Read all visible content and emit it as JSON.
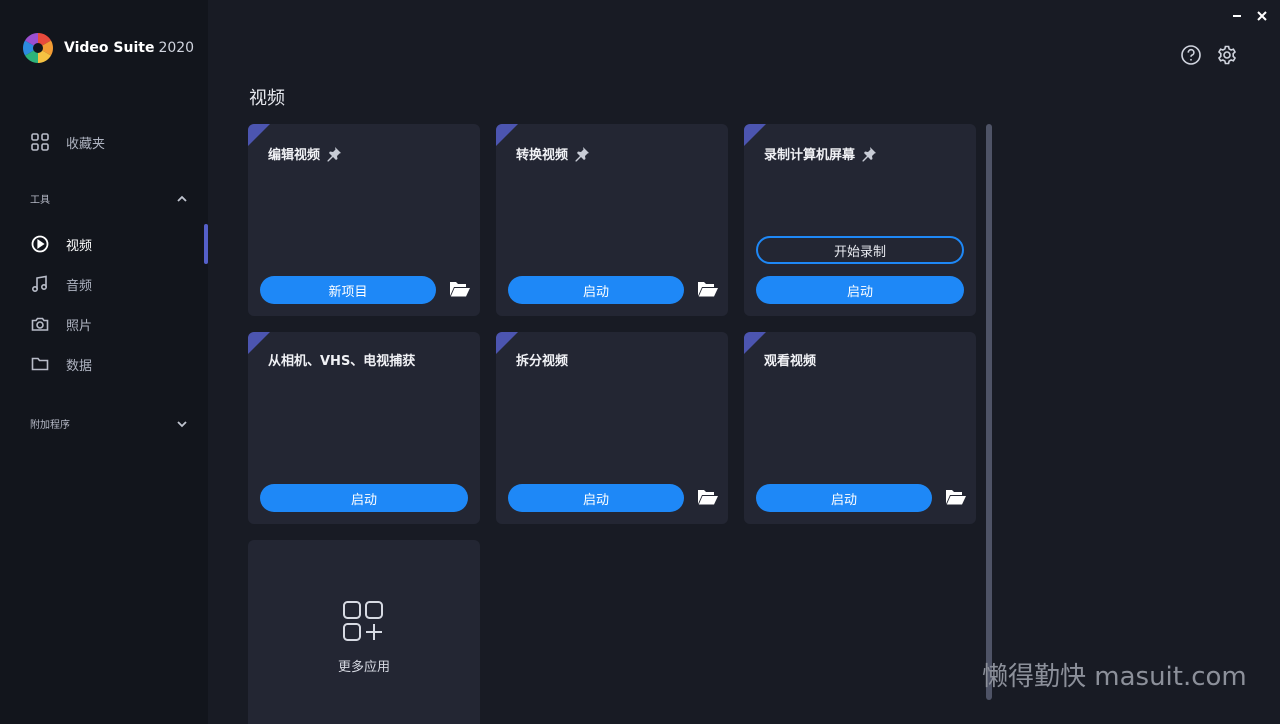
{
  "app": {
    "name": "Video Suite",
    "year": "2020"
  },
  "sidebar": {
    "favorites_label": "收藏夹",
    "tools_section": "工具",
    "items": [
      {
        "label": "视频",
        "icon": "play-circle-icon",
        "active": true
      },
      {
        "label": "音频",
        "icon": "music-note-icon",
        "active": false
      },
      {
        "label": "照片",
        "icon": "camera-icon",
        "active": false
      },
      {
        "label": "数据",
        "icon": "folder-icon",
        "active": false
      }
    ],
    "addons_section": "附加程序"
  },
  "page_title": "视频",
  "cards": [
    {
      "title": "编辑视频",
      "pinned": true,
      "button": "新项目",
      "has_folder": true
    },
    {
      "title": "转换视频",
      "pinned": true,
      "button": "启动",
      "has_folder": true
    },
    {
      "title": "录制计算机屏幕",
      "pinned": true,
      "secondary_button": "开始录制",
      "button": "启动",
      "has_folder": false
    },
    {
      "title": "从相机、VHS、电视捕获",
      "pinned": false,
      "button": "启动",
      "has_folder": false
    },
    {
      "title": "拆分视频",
      "pinned": false,
      "button": "启动",
      "has_folder": true
    },
    {
      "title": "观看视频",
      "pinned": false,
      "button": "启动",
      "has_folder": true
    }
  ],
  "more_apps_label": "更多应用",
  "watermark": "懒得勤快 masuit.com",
  "colors": {
    "accent": "#1e88f7",
    "corner": "#4c55b0",
    "card_bg": "#232633",
    "sidebar_bg": "#12151c",
    "main_bg": "#181b24"
  }
}
